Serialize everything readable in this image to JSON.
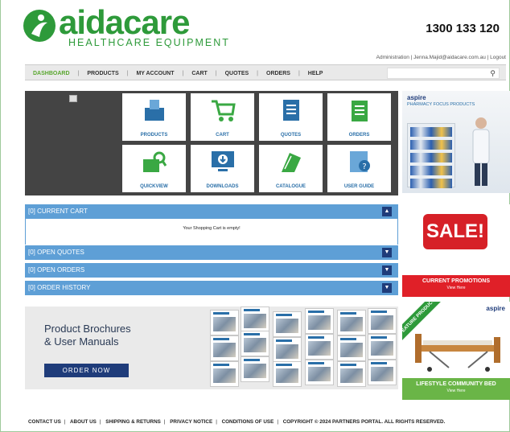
{
  "header": {
    "logo_primary": "aida",
    "logo_secondary": "care",
    "logo_subtitle": "HEALTHCARE EQUIPMENT",
    "phone": "1300 133 120",
    "admin_line": "Administration | Jenna.Majid@aidacare.com.au | Logout"
  },
  "nav": {
    "items": [
      "DASHBOARD",
      "PRODUCTS",
      "MY ACCOUNT",
      "CART",
      "QUOTES",
      "ORDERS",
      "HELP"
    ],
    "search_placeholder": "",
    "search_icon": "search-icon"
  },
  "tiles": [
    {
      "label": "PRODUCTS",
      "icon": "boxes-icon"
    },
    {
      "label": "CART",
      "icon": "cart-icon"
    },
    {
      "label": "QUOTES",
      "icon": "document-icon"
    },
    {
      "label": "ORDERS",
      "icon": "clipboard-icon"
    },
    {
      "label": "QUICKVIEW",
      "icon": "magnify-box-icon"
    },
    {
      "label": "DOWNLOADS",
      "icon": "download-monitor-icon"
    },
    {
      "label": "CATALOGUE",
      "icon": "catalogue-icon"
    },
    {
      "label": "USER GUIDE",
      "icon": "help-guide-icon"
    }
  ],
  "pharmacy_promo": {
    "brand": "aspire",
    "subtitle": "PHARMACY FOCUS PRODUCTS"
  },
  "accordion": {
    "current_cart": "[0] CURRENT CART",
    "cart_empty": "Your Shopping Cart is empty!",
    "open_quotes": "[0] OPEN QUOTES",
    "open_orders": "[0] OPEN ORDERS",
    "order_history": "[0] ORDER HISTORY"
  },
  "sale": {
    "sign": "SALE!",
    "title": "CURRENT PROMOTIONS",
    "link": "View Here"
  },
  "brochure": {
    "title_line1": "Product Brochures",
    "title_line2": "& User Manuals",
    "button": "ORDER NOW"
  },
  "feature": {
    "ribbon": "FEATURE PRODUCT",
    "brand": "aspire",
    "title": "LIFESTYLE COMMUNITY BED",
    "link": "View Here"
  },
  "footer": {
    "links": [
      "CONTACT US",
      "ABOUT US",
      "SHIPPING & RETURNS",
      "PRIVACY NOTICE",
      "CONDITIONS OF USE"
    ],
    "copyright": "COPYRIGHT © 2024 PARTNERS PORTAL. ALL RIGHTS RESERVED."
  },
  "colors": {
    "brand_green": "#2e9a3a",
    "accordion_blue": "#5e9fd6",
    "navy": "#1f3c7a",
    "sale_red": "#e02028"
  }
}
